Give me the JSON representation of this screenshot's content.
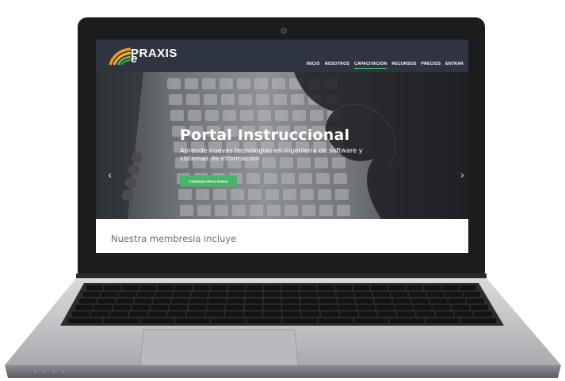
{
  "site": {
    "logo_text": "PRAXIS",
    "logo_prefix": "e",
    "nav": [
      {
        "label": "INICIO"
      },
      {
        "label": "NOSOTROS"
      },
      {
        "label": "CAPACITACION",
        "active": true
      },
      {
        "label": "RECURSOS"
      },
      {
        "label": "PRECIOS"
      },
      {
        "label": "ENTRAR"
      }
    ]
  },
  "hero": {
    "title": "Portal Instruccional",
    "subtitle": "Aprende nuevas tecnologias en Ingenieria de software y sistemas de informacion",
    "cta_label": "Comienza ahora mismo",
    "prev_icon": "chevron-left-icon",
    "next_icon": "chevron-right-icon"
  },
  "section": {
    "title": "Nuestra membresia incluye"
  },
  "colors": {
    "header_bg": "#2f3540",
    "accent": "#48b56b",
    "logo_orange": "#f39a1e",
    "logo_green": "#6cbf3b"
  }
}
